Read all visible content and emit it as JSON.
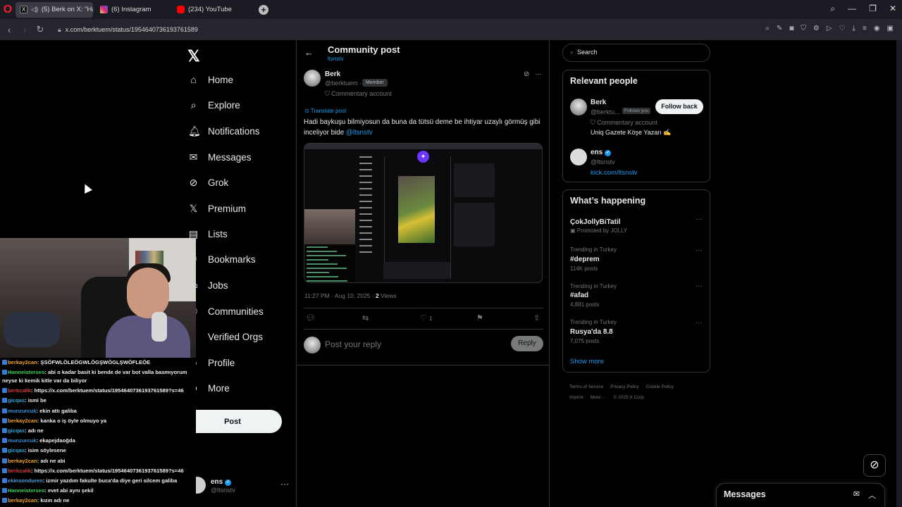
{
  "browser": {
    "tabs": [
      {
        "label": "(5) Berk on X: \"Hadi b",
        "favicon_color": "#000000"
      },
      {
        "label": "(6) Instagram",
        "favicon_color": "#d6249f"
      },
      {
        "label": "(234) YouTube",
        "favicon_color": "#ff0000"
      }
    ],
    "url": "x.com/berktuem/status/1954640736193761589"
  },
  "nav": {
    "items": [
      {
        "label": "Home",
        "icon": "home-icon"
      },
      {
        "label": "Explore",
        "icon": "search-icon"
      },
      {
        "label": "Notifications",
        "icon": "bell-icon"
      },
      {
        "label": "Messages",
        "icon": "envelope-icon"
      },
      {
        "label": "Grok",
        "icon": "grok-icon"
      },
      {
        "label": "Premium",
        "icon": "x-icon"
      },
      {
        "label": "Lists",
        "icon": "list-icon"
      },
      {
        "label": "Bookmarks",
        "icon": "bookmark-icon"
      },
      {
        "label": "Jobs",
        "icon": "briefcase-icon"
      },
      {
        "label": "Communities",
        "icon": "people-icon"
      },
      {
        "label": "Verified Orgs",
        "icon": "lightning-icon"
      },
      {
        "label": "Profile",
        "icon": "person-icon"
      },
      {
        "label": "More",
        "icon": "more-circle-icon"
      }
    ],
    "post_label": "Post",
    "account": {
      "name": "ens",
      "handle": "@ltsnstv"
    }
  },
  "header": {
    "title": "Community post",
    "subtitle": "ltsnstv"
  },
  "post": {
    "author_name": "Berk",
    "author_handle": "@berktuem ·",
    "member_badge": "Member",
    "commentary": "Commentary account",
    "translate": "Translate post",
    "text": "Hadi baykuşu bilmiyosun da buna da tütsü deme be ihtiyar uzaylı görmüş gibi inceliyor bide ",
    "mention": "@ltsnstv",
    "time": "11:27 PM · Aug 10, 2025 · ",
    "views_count": "2",
    "views_label": " Views",
    "like_count": "1"
  },
  "reply": {
    "placeholder": "Post your reply",
    "button": "Reply"
  },
  "search": {
    "placeholder": "Search"
  },
  "relevant": {
    "title": "Relevant people",
    "people": [
      {
        "name": "Berk",
        "handle": "@berktu...",
        "follows_you": "Follows you",
        "bio_prefix": "Commentary account",
        "bio": "Uniq Gazete Köşe Yazarı ✍",
        "button": "Follow back"
      },
      {
        "name": "ens",
        "handle": "@ltsnstv",
        "link": "kick.com/ltsnstv"
      }
    ]
  },
  "happening": {
    "title": "What’s happening",
    "trends": [
      {
        "category": "Promoted by JOLLY",
        "name": "ÇokJollyBiTatil",
        "count": ""
      },
      {
        "category": "Trending in Turkey",
        "name": "#deprem",
        "count": "114K posts"
      },
      {
        "category": "Trending in Turkey",
        "name": "#afad",
        "count": "4,881 posts"
      },
      {
        "category": "Trending in Turkey",
        "name": "Rusya'da 8.8",
        "count": "7,075 posts"
      }
    ],
    "show_more": "Show more"
  },
  "footer": [
    "Terms of Service",
    "Privacy Policy",
    "Cookie Policy",
    "Imprint",
    "More ···",
    "© 2025 X Corp."
  ],
  "messages_drawer": {
    "title": "Messages"
  },
  "chat": [
    {
      "user": "berkay2can",
      "color": "#f0a030",
      "msg": ": ŞSÖFWLÖLEÖGWLÖGŞWÖGLŞWÖFLEÖE"
    },
    {
      "user": "Hanneisterseo",
      "color": "#3ad15a",
      "msg": ": abi o kadar basit ki bende de var bot valla basmıyorum neyse ki kemik kitle var da biliyor",
      "wrap": true
    },
    {
      "user": "berkcalik",
      "color": "#d43a3a",
      "msg": ": https://x.com/berktuem/status/1954640736193761589?s=46"
    },
    {
      "user": "gicqas",
      "color": "#2fa8d8",
      "msg": ": ismi be"
    },
    {
      "user": "munzurcuk",
      "color": "#3a8fd4",
      "msg": ": ekin attı galiba"
    },
    {
      "user": "berkay2can",
      "color": "#f0a030",
      "msg": ": kanka o iş öyle olmuyo ya"
    },
    {
      "user": "gicqas",
      "color": "#2fa8d8",
      "msg": ": adı ne"
    },
    {
      "user": "munzurcuk",
      "color": "#3a8fd4",
      "msg": ": ekapejdaoğda"
    },
    {
      "user": "gicqas",
      "color": "#2fa8d8",
      "msg": ": isim söylesene"
    },
    {
      "user": "berkay2can",
      "color": "#f0a030",
      "msg": ": adı ne abi"
    },
    {
      "user": "berkcalik",
      "color": "#d43a3a",
      "msg": ": https://x.com/berktuem/status/1954640736193761589?s=46"
    },
    {
      "user": "ekinsonduren",
      "color": "#4a9ad8",
      "msg": ": izmir yazdım fakulte buca'da diye geri silcem galiba"
    },
    {
      "user": "Hanneisterseo",
      "color": "#3ad15a",
      "msg": ": evet abi aynı şekil"
    },
    {
      "user": "berkay2can",
      "color": "#f0a030",
      "msg": ": kızın adı ne"
    }
  ]
}
